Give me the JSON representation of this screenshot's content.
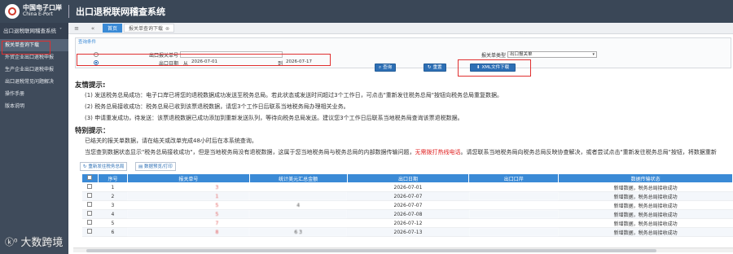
{
  "header": {
    "logo_cn": "中国电子口岸",
    "logo_en": "China E-Port",
    "app_title": "出口退税联网稽查系统"
  },
  "sidebar": {
    "section_title": "出口退税联网稽查系统",
    "items": [
      {
        "label": "报关单查询下载",
        "active": true
      },
      {
        "label": "外贸企业出口退税申报",
        "active": false
      },
      {
        "label": "生产企业出口退税申报",
        "active": false
      },
      {
        "label": "出口退税常见问题解决",
        "active": false
      },
      {
        "label": "操作手册",
        "active": false
      },
      {
        "label": "版本说明",
        "active": false
      }
    ]
  },
  "tabs": {
    "home_icon": "home-icon",
    "menu_icon": "double-chevron-icon",
    "items": [
      {
        "label": "首页",
        "active": true
      },
      {
        "label": "报关单查询下载",
        "active": false
      }
    ]
  },
  "query": {
    "legend": "查询条件",
    "declaration_no_label": "出口报关单号",
    "declaration_no_value": "",
    "export_date_label": "出口日期",
    "from_label": "从",
    "from_value": "2026-07-01",
    "to_label": "到",
    "to_value": "2026-07-17",
    "type_label": "报关单类型",
    "type_value": "出口报关单",
    "selected_option": 2
  },
  "buttons": {
    "query": "查询",
    "reset": "重置",
    "xml_download": "XML文件下载"
  },
  "tips": {
    "title": "友情提示:",
    "line1": "(1) 发送税务总局成功：电子口岸已将您的退税数据成功发送至税务总局。若此状态或发送时间超过3个工作日，可点击\"重新发往税务总局\"按钮向税务总局重复数据。",
    "line2": "(2) 税务总局接收成功：税务总局已收到该票退税数据，请您3个工作日后联系当地税务局办理相关业务。",
    "line3": "(3) 申请重发成功，待发送：该票退税数据已成功添加到重新发送队列，等待向税务总局发送。建议您3个工作日后联系当地税务局查询该票退税数据。",
    "special_title": "特别提示：",
    "special1": "已结关的报关单数据，请在结关或改单完成48小时后在本系统查询。",
    "special2a": "当您查到数据状态显示\"税务总局接收成功\"，但是当地税务局没有退税数据，这属于您当地税务局与税务总局的内部数据传输问题，",
    "special2b": "无需拨打热线电话",
    "special2c": "。请您联系当地税务局向税务总局反映协查解决，或者尝试点击\"重新发往税务总局\"按钮，将数据重新"
  },
  "toolbar": {
    "resend": "重新发往税务总局",
    "print": "数据预览/打印"
  },
  "table": {
    "headers": [
      "序号",
      "报关单号",
      "统计美元汇总金额",
      "出口日期",
      "出口口岸",
      "数据传输状态"
    ],
    "rows": [
      {
        "index": "1",
        "decl": "3",
        "amount": "",
        "date": "2026-07-01",
        "port": "",
        "status": "新增数据，税务总局接收成功"
      },
      {
        "index": "2",
        "decl": "1",
        "amount": "",
        "date": "2026-07-07",
        "port": "",
        "status": "新增数据，税务总局接收成功"
      },
      {
        "index": "3",
        "decl": "5",
        "amount": "4",
        "date": "2026-07-07",
        "port": "",
        "status": "新增数据，税务总局接收成功"
      },
      {
        "index": "4",
        "decl": "5",
        "amount": "",
        "date": "2026-07-08",
        "port": "",
        "status": "新增数据，税务总局接收成功"
      },
      {
        "index": "5",
        "decl": "7",
        "amount": "",
        "date": "2026-07-12",
        "port": "",
        "status": "新增数据，税务总局接收成功"
      },
      {
        "index": "6",
        "decl": "8",
        "amount": "6 3",
        "date": "2026-07-13",
        "port": "",
        "status": "新增数据，税务总局接收成功"
      }
    ]
  },
  "watermark": "大数跨境",
  "colors": {
    "header_bg": "#3a4757",
    "sidebar_bg": "#3f4b5b",
    "accent_blue": "#2d6fb5",
    "table_header": "#3a8ad6",
    "highlight_red": "#e03030"
  }
}
